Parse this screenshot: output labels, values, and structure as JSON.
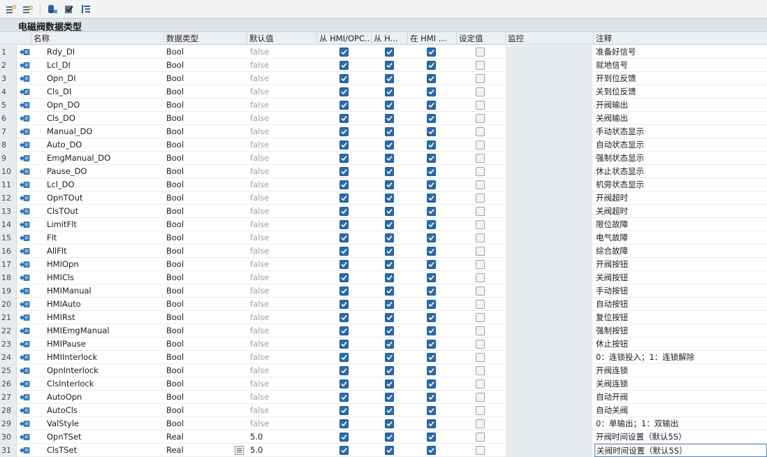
{
  "toolbar": {
    "buttons": [
      "insert-row-icon",
      "add-row-icon",
      "database-icon",
      "apply-icon",
      "expand-all-icon"
    ]
  },
  "title": "电磁阀数据类型",
  "columns": {
    "name": "名称",
    "datatype": "数据类型",
    "default": "默认值",
    "hmi_opc": "从 HMI/OPC..",
    "hmi_h": "从 H...",
    "in_hmi": "在 HMI ...",
    "setpoint": "设定值",
    "monitor": "监控",
    "comment": "注释"
  },
  "colors": {
    "checkbox_on": "#2a6ba8",
    "header_bg": "#edf0f3",
    "title_bg": "#dfe3e8",
    "default_text": "#9aa0a6"
  },
  "rows": [
    {
      "num": "1",
      "name": "Rdy_DI",
      "type": "Bool",
      "def": "false",
      "cmt": "准备好信号"
    },
    {
      "num": "2",
      "name": "Lcl_DI",
      "type": "Bool",
      "def": "false",
      "cmt": "就地信号"
    },
    {
      "num": "3",
      "name": "Opn_DI",
      "type": "Bool",
      "def": "false",
      "cmt": "开到位反馈"
    },
    {
      "num": "4",
      "name": "Cls_DI",
      "type": "Bool",
      "def": "false",
      "cmt": "关到位反馈"
    },
    {
      "num": "5",
      "name": "Opn_DO",
      "type": "Bool",
      "def": "false",
      "cmt": "开阀输出"
    },
    {
      "num": "6",
      "name": "Cls_DO",
      "type": "Bool",
      "def": "false",
      "cmt": "关阀输出"
    },
    {
      "num": "7",
      "name": "Manual_DO",
      "type": "Bool",
      "def": "false",
      "cmt": "手动状态显示"
    },
    {
      "num": "8",
      "name": "Auto_DO",
      "type": "Bool",
      "def": "false",
      "cmt": "自动状态显示"
    },
    {
      "num": "9",
      "name": "EmgManual_DO",
      "type": "Bool",
      "def": "false",
      "cmt": "强制状态显示"
    },
    {
      "num": "10",
      "name": "Pause_DO",
      "type": "Bool",
      "def": "false",
      "cmt": "休止状态显示"
    },
    {
      "num": "11",
      "name": "Lcl_DO",
      "type": "Bool",
      "def": "false",
      "cmt": "机旁状态显示"
    },
    {
      "num": "12",
      "name": "OpnTOut",
      "type": "Bool",
      "def": "false",
      "cmt": "开阀超时"
    },
    {
      "num": "13",
      "name": "ClsTOut",
      "type": "Bool",
      "def": "false",
      "cmt": "关阀超时"
    },
    {
      "num": "14",
      "name": "LimitFlt",
      "type": "Bool",
      "def": "false",
      "cmt": "限位故障"
    },
    {
      "num": "15",
      "name": "Flt",
      "type": "Bool",
      "def": "false",
      "cmt": "电气故障"
    },
    {
      "num": "16",
      "name": "AllFlt",
      "type": "Bool",
      "def": "false",
      "cmt": "综合故障"
    },
    {
      "num": "17",
      "name": "HMIOpn",
      "type": "Bool",
      "def": "false",
      "cmt": "开阀按钮"
    },
    {
      "num": "18",
      "name": "HMICls",
      "type": "Bool",
      "def": "false",
      "cmt": "关阀按钮"
    },
    {
      "num": "19",
      "name": "HMIManual",
      "type": "Bool",
      "def": "false",
      "cmt": "手动按钮"
    },
    {
      "num": "20",
      "name": "HMIAuto",
      "type": "Bool",
      "def": "false",
      "cmt": "自动按钮"
    },
    {
      "num": "21",
      "name": "HMIRst",
      "type": "Bool",
      "def": "false",
      "cmt": "复位按钮"
    },
    {
      "num": "22",
      "name": "HMIEmgManual",
      "type": "Bool",
      "def": "false",
      "cmt": "强制按钮"
    },
    {
      "num": "23",
      "name": "HMIPause",
      "type": "Bool",
      "def": "false",
      "cmt": "休止按钮"
    },
    {
      "num": "24",
      "name": "HMIInterlock",
      "type": "Bool",
      "def": "false",
      "cmt": "0：连锁投入；1：连锁解除"
    },
    {
      "num": "25",
      "name": "OpnInterlock",
      "type": "Bool",
      "def": "false",
      "cmt": "开阀连锁"
    },
    {
      "num": "26",
      "name": "ClsInterlock",
      "type": "Bool",
      "def": "false",
      "cmt": "关阀连锁"
    },
    {
      "num": "27",
      "name": "AutoOpn",
      "type": "Bool",
      "def": "false",
      "cmt": "自动开阀"
    },
    {
      "num": "28",
      "name": "AutoCls",
      "type": "Bool",
      "def": "false",
      "cmt": "自动关阀"
    },
    {
      "num": "29",
      "name": "ValStyle",
      "type": "Bool",
      "def": "false",
      "cmt": "0：单输出；1：双输出"
    },
    {
      "num": "30",
      "name": "OpnTSet",
      "type": "Real",
      "def": "5.0",
      "cmt": "开阀时间设置（默认5S）"
    },
    {
      "num": "31",
      "name": "ClsTSet",
      "type": "Real",
      "def": "5.0",
      "cmt": "关阀时间设置（默认5S）"
    }
  ]
}
